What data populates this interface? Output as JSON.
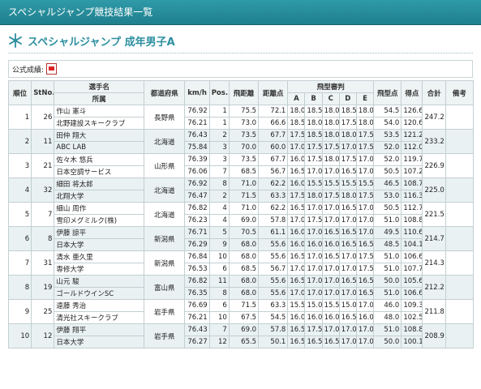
{
  "page": {
    "window_title": "スペシャルジャンプ競技結果一覧",
    "heading": "スペシャルジャンプ 成年男子A",
    "official_label": "公式成績:"
  },
  "headers": {
    "rank": "順位",
    "stno": "StNo.",
    "name": "選手名",
    "affiliation": "所属",
    "pref": "都道府県",
    "kmh": "km/h",
    "pos": "Pos.",
    "distance": "飛距離",
    "dist_points": "距離点",
    "style_judges": "飛型審判",
    "judge_a": "A",
    "judge_b": "B",
    "judge_c": "C",
    "judge_d": "D",
    "judge_e": "E",
    "style_points": "飛型点",
    "score": "得点",
    "total": "合計",
    "remarks": "備考"
  },
  "athletes": [
    {
      "rank": "1",
      "stno": "26",
      "name": "作山 憲斗",
      "affiliation": "北野建設スキークラブ",
      "pref": "長野県",
      "total": "247.2",
      "jumps": [
        {
          "kmh": "76.92",
          "pos": "1",
          "dist": "75.5",
          "dpts": "72.1",
          "a": "18.0",
          "b": "18.5",
          "c": "18.0",
          "d": "18.5",
          "e": "18.0",
          "spts": "54.5",
          "score": "126.6"
        },
        {
          "kmh": "76.21",
          "pos": "1",
          "dist": "73.0",
          "dpts": "66.6",
          "a": "18.5",
          "b": "18.0",
          "c": "18.0",
          "d": "17.5",
          "e": "18.0",
          "spts": "54.0",
          "score": "120.6"
        }
      ]
    },
    {
      "rank": "2",
      "stno": "11",
      "name": "田仲 翔大",
      "affiliation": "ABC LAB",
      "pref": "北海道",
      "total": "233.2",
      "jumps": [
        {
          "kmh": "76.43",
          "pos": "2",
          "dist": "73.5",
          "dpts": "67.7",
          "a": "17.5",
          "b": "18.5",
          "c": "18.0",
          "d": "18.0",
          "e": "17.5",
          "spts": "53.5",
          "score": "121.2"
        },
        {
          "kmh": "75.84",
          "pos": "3",
          "dist": "70.0",
          "dpts": "60.0",
          "a": "17.0",
          "b": "17.5",
          "c": "17.5",
          "d": "17.0",
          "e": "17.5",
          "spts": "52.0",
          "score": "112.0"
        }
      ]
    },
    {
      "rank": "3",
      "stno": "21",
      "name": "佐々木 悠兵",
      "affiliation": "日本空調サービス",
      "pref": "山形県",
      "total": "226.9",
      "jumps": [
        {
          "kmh": "76.39",
          "pos": "3",
          "dist": "73.5",
          "dpts": "67.7",
          "a": "16.0",
          "b": "17.5",
          "c": "18.0",
          "d": "17.5",
          "e": "17.0",
          "spts": "52.0",
          "score": "119.7"
        },
        {
          "kmh": "76.06",
          "pos": "7",
          "dist": "68.5",
          "dpts": "56.7",
          "a": "16.5",
          "b": "17.0",
          "c": "17.0",
          "d": "16.5",
          "e": "17.0",
          "spts": "50.5",
          "score": "107.2"
        }
      ]
    },
    {
      "rank": "4",
      "stno": "32",
      "name": "細田 将太郎",
      "affiliation": "北翔大学",
      "pref": "北海道",
      "total": "225.0",
      "jumps": [
        {
          "kmh": "76.92",
          "pos": "8",
          "dist": "71.0",
          "dpts": "62.2",
          "a": "16.0",
          "b": "15.5",
          "c": "15.5",
          "d": "15.5",
          "e": "15.5",
          "spts": "46.5",
          "score": "108.7"
        },
        {
          "kmh": "76.47",
          "pos": "2",
          "dist": "71.5",
          "dpts": "63.3",
          "a": "17.5",
          "b": "18.0",
          "c": "17.5",
          "d": "18.0",
          "e": "17.5",
          "spts": "53.0",
          "score": "116.3"
        }
      ]
    },
    {
      "rank": "5",
      "stno": "7",
      "name": "細山 周作",
      "affiliation": "雪印メグミルク(株)",
      "pref": "北海道",
      "total": "221.5",
      "jumps": [
        {
          "kmh": "76.82",
          "pos": "4",
          "dist": "71.0",
          "dpts": "62.2",
          "a": "16.5",
          "b": "17.0",
          "c": "17.0",
          "d": "16.5",
          "e": "17.0",
          "spts": "50.5",
          "score": "112.7"
        },
        {
          "kmh": "76.23",
          "pos": "4",
          "dist": "69.0",
          "dpts": "57.8",
          "a": "17.0",
          "b": "17.5",
          "c": "17.0",
          "d": "17.0",
          "e": "17.0",
          "spts": "51.0",
          "score": "108.8"
        }
      ]
    },
    {
      "rank": "6",
      "stno": "8",
      "name": "伊藤 諒平",
      "affiliation": "日本大学",
      "pref": "新潟県",
      "total": "214.7",
      "jumps": [
        {
          "kmh": "76.71",
          "pos": "5",
          "dist": "70.5",
          "dpts": "61.1",
          "a": "16.0",
          "b": "17.0",
          "c": "16.5",
          "d": "16.5",
          "e": "17.0",
          "spts": "49.5",
          "score": "110.6"
        },
        {
          "kmh": "76.29",
          "pos": "9",
          "dist": "68.0",
          "dpts": "55.6",
          "a": "16.0",
          "b": "16.0",
          "c": "16.0",
          "d": "16.5",
          "e": "16.5",
          "spts": "48.5",
          "score": "104.1"
        }
      ]
    },
    {
      "rank": "7",
      "stno": "31",
      "name": "清水 亜久里",
      "affiliation": "専修大学",
      "pref": "新潟県",
      "total": "214.3",
      "jumps": [
        {
          "kmh": "76.84",
          "pos": "10",
          "dist": "68.0",
          "dpts": "55.6",
          "a": "16.5",
          "b": "17.0",
          "c": "16.5",
          "d": "17.0",
          "e": "17.5",
          "spts": "51.0",
          "score": "106.6"
        },
        {
          "kmh": "76.53",
          "pos": "6",
          "dist": "68.5",
          "dpts": "56.7",
          "a": "17.0",
          "b": "17.0",
          "c": "17.0",
          "d": "17.0",
          "e": "17.5",
          "spts": "51.0",
          "score": "107.7"
        }
      ]
    },
    {
      "rank": "8",
      "stno": "19",
      "name": "山元 駿",
      "affiliation": "ゴールドウインSC",
      "pref": "富山県",
      "total": "212.2",
      "jumps": [
        {
          "kmh": "76.82",
          "pos": "11",
          "dist": "68.0",
          "dpts": "55.6",
          "a": "16.5",
          "b": "17.0",
          "c": "17.0",
          "d": "16.5",
          "e": "16.5",
          "spts": "50.0",
          "score": "105.6"
        },
        {
          "kmh": "76.35",
          "pos": "8",
          "dist": "68.0",
          "dpts": "55.6",
          "a": "17.0",
          "b": "17.0",
          "c": "17.0",
          "d": "17.0",
          "e": "16.5",
          "spts": "51.0",
          "score": "106.6"
        }
      ]
    },
    {
      "rank": "9",
      "stno": "25",
      "name": "遠藤 秀治",
      "affiliation": "清光社スキークラブ",
      "pref": "岩手県",
      "total": "211.8",
      "jumps": [
        {
          "kmh": "76.69",
          "pos": "6",
          "dist": "71.5",
          "dpts": "63.3",
          "a": "15.5",
          "b": "15.0",
          "c": "15.5",
          "d": "15.0",
          "e": "17.0",
          "spts": "46.0",
          "score": "109.3"
        },
        {
          "kmh": "76.21",
          "pos": "10",
          "dist": "67.5",
          "dpts": "54.5",
          "a": "16.0",
          "b": "16.0",
          "c": "16.0",
          "d": "16.5",
          "e": "16.0",
          "spts": "48.0",
          "score": "102.5"
        }
      ]
    },
    {
      "rank": "10",
      "stno": "12",
      "name": "伊藤 翔平",
      "affiliation": "日本大学",
      "pref": "岩手県",
      "total": "208.9",
      "jumps": [
        {
          "kmh": "76.43",
          "pos": "7",
          "dist": "69.0",
          "dpts": "57.8",
          "a": "16.5",
          "b": "17.5",
          "c": "17.0",
          "d": "17.0",
          "e": "17.0",
          "spts": "51.0",
          "score": "108.8"
        },
        {
          "kmh": "76.27",
          "pos": "12",
          "dist": "65.5",
          "dpts": "50.1",
          "a": "16.5",
          "b": "16.5",
          "c": "16.5",
          "d": "17.0",
          "e": "17.0",
          "spts": "50.0",
          "score": "100.1"
        }
      ]
    }
  ]
}
